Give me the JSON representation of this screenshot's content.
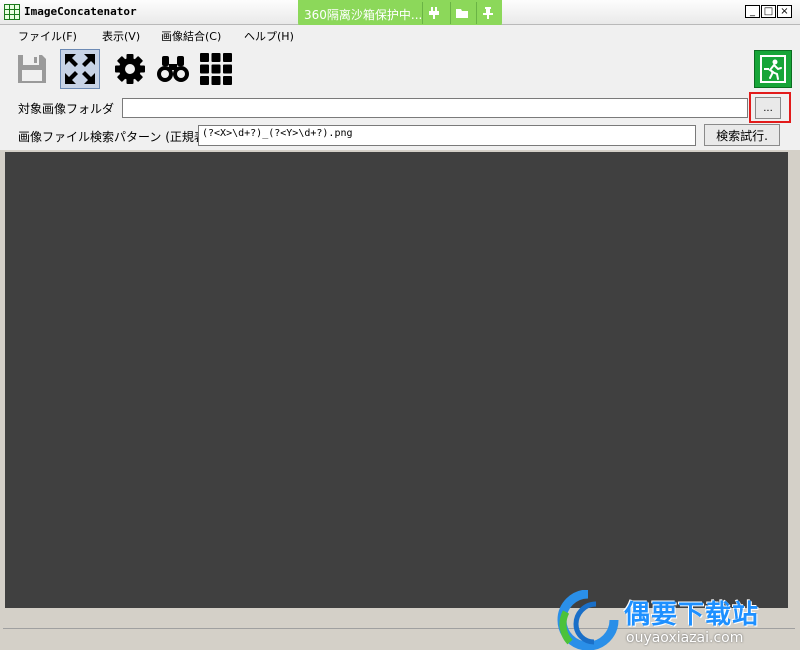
{
  "window": {
    "title": "ImageConcatenator"
  },
  "sandbox": {
    "label": "360隔离沙箱保护中...",
    "icons": [
      "plug-icon",
      "folder-icon",
      "pin-icon"
    ]
  },
  "menu": [
    {
      "label": "ファイル(F)"
    },
    {
      "label": "表示(V)"
    },
    {
      "label": "画像結合(C)"
    },
    {
      "label": "ヘルプ(H)"
    }
  ],
  "toolbar": {
    "buttons": [
      "save-icon",
      "fit-expand-icon",
      "gear-icon",
      "binoculars-icon",
      "grid-icon"
    ],
    "active": "fit-expand-icon",
    "exit": "exit-door-icon"
  },
  "form": {
    "folder_label": "対象画像フォルダ",
    "folder_value": "",
    "browse_label": "...",
    "pattern_label": "画像ファイル検索パターン (正規表",
    "pattern_value": "(?<X>\\d+?)_(?<Y>\\d+?).png",
    "search_button": "検索試行."
  },
  "watermark": {
    "name": "偶要下载站",
    "url": "ouyaoxiazai.com"
  },
  "colors": {
    "canvas": "#404040",
    "exit_green": "#17a538",
    "sandbox_green": "#8cd85a",
    "highlight_red": "#e21b1b"
  }
}
